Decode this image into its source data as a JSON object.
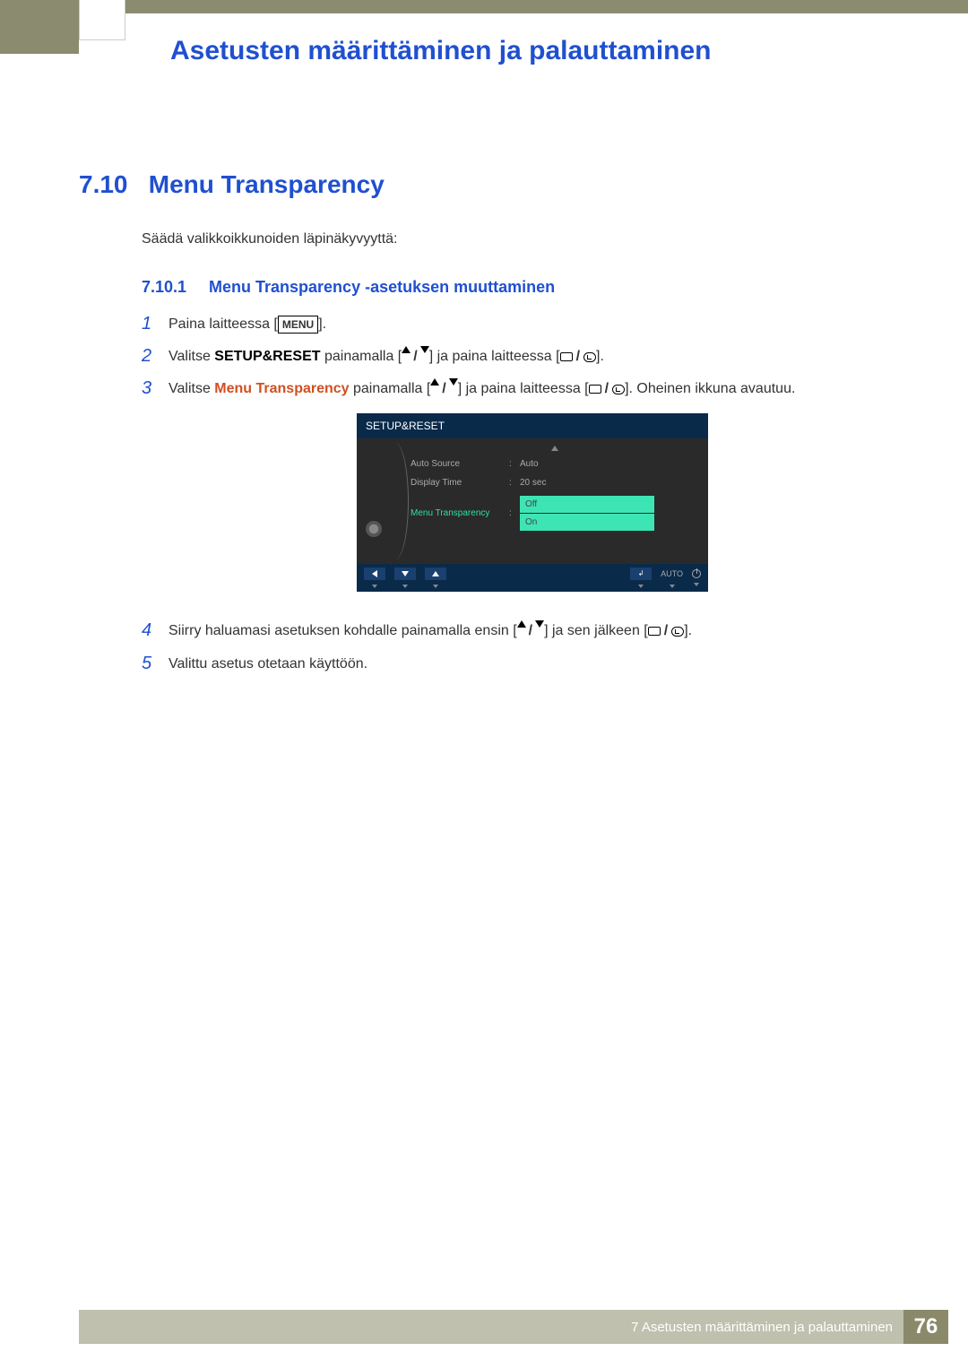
{
  "chapter_title": "Asetusten määrittäminen ja palauttaminen",
  "section": {
    "number": "7.10",
    "title": "Menu Transparency"
  },
  "intro": "Säädä valikkoikkunoiden läpinäkyvyyttä:",
  "subsection": {
    "number": "7.10.1",
    "title": "Menu Transparency -asetuksen muuttaminen"
  },
  "steps": {
    "s1": {
      "num": "1",
      "a": "Paina laitteessa [",
      "menu": "MENU",
      "b": "]."
    },
    "s2": {
      "num": "2",
      "a": "Valitse ",
      "bold": "SETUP&RESET",
      "b": " painamalla [",
      "c": "] ja paina laitteessa [",
      "d": "]."
    },
    "s3": {
      "num": "3",
      "a": "Valitse ",
      "orange": "Menu Transparency",
      "b": " painamalla [",
      "c": "] ja paina laitteessa [",
      "d": "]. Oheinen ikkuna avautuu."
    },
    "s4": {
      "num": "4",
      "a": "Siirry haluamasi asetuksen kohdalle painamalla ensin [",
      "b": "] ja sen jälkeen [",
      "c": "]."
    },
    "s5": {
      "num": "5",
      "a": "Valittu asetus otetaan käyttöön."
    }
  },
  "osd": {
    "title": "SETUP&RESET",
    "rows": {
      "r1": {
        "label": "Auto Source",
        "value": "Auto"
      },
      "r2": {
        "label": "Display Time",
        "value": "20 sec"
      },
      "r3": {
        "label": "Menu Transparency",
        "opt1": "Off",
        "opt2": "On"
      }
    },
    "nav_auto": "AUTO"
  },
  "footer": {
    "text": "7 Asetusten määrittäminen ja palauttaminen",
    "page": "76"
  }
}
